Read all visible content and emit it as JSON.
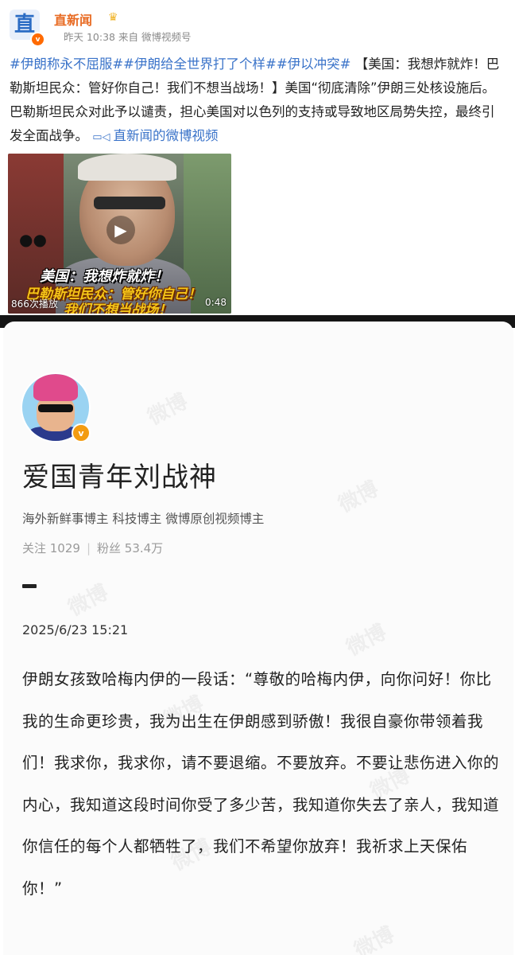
{
  "post": {
    "author": "直新闻",
    "avatar_char": "直",
    "verified_mark": "v",
    "meta": "昨天 10:38 来自 微博视频号",
    "hashtags": [
      "#伊朗称永不屈服#",
      "#伊朗给全世界打了个样#",
      "#伊以冲突#"
    ],
    "text": " 【美国：我想炸就炸！巴勒斯坦民众：管好你自己！我们不想当战场！】美国“彻底清除”伊朗三处核设施后。巴勒斯坦民众对此予以谴责，担心美国对以色列的支持或导致地区局势失控，最终引发全面战争。",
    "video_link": "直新闻的微博视频",
    "video": {
      "caption_1": "美国：我想炸就炸！",
      "caption_2": "巴勒斯坦民众：管好你自己！",
      "caption_3": "我们不想当战场！",
      "play_count": "866次播放",
      "duration": "0:48"
    }
  },
  "profile": {
    "name": "爱国青年刘战神",
    "verified_mark": "v",
    "tags": "海外新鲜事博主 科技博主 微博原创视频博主",
    "following": "关注 1029",
    "followers": "粉丝 53.4万",
    "date": "2025/6/23 15:21",
    "body": "伊朗女孩致哈梅内伊的一段话：“尊敬的哈梅内伊，向你问好！你比我的生命更珍贵，我为出生在伊朗感到骄傲！我很自豪你带领着我们！我求你，我求你，请不要退缩。不要放弃。不要让悲伤进入你的内心，我知道这段时间你受了多少苦，我知道你失去了亲人，我知道你信任的每个人都牺牲了，我们不希望你放弃！我祈求上天保佑你！”",
    "watermark": "微博"
  },
  "colors": {
    "author": "#e86b23",
    "link": "#3a73c9",
    "badge": "#f39c12"
  }
}
